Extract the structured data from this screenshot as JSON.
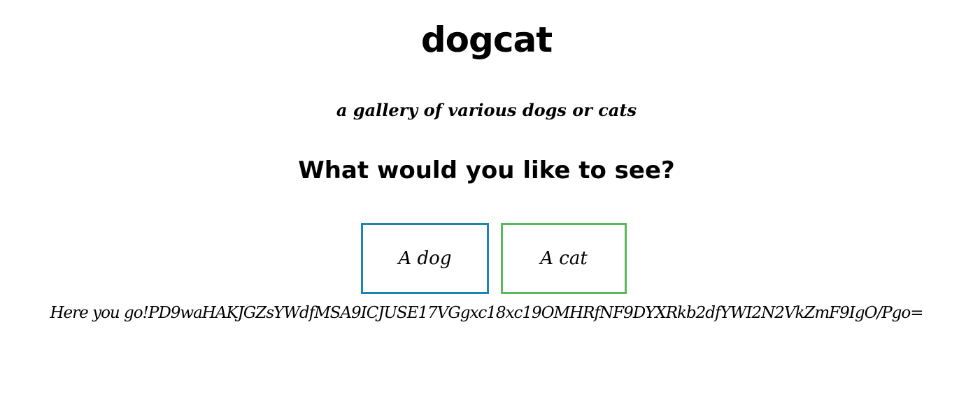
{
  "header": {
    "title": "dogcat",
    "subtitle": "a gallery of various dogs or cats"
  },
  "main": {
    "question": "What would you like to see?",
    "buttons": {
      "dog_label": "A dog",
      "cat_label": "A cat"
    },
    "result": {
      "prefix": "Here you go!",
      "payload": "PD9waHAKJGZsYWdfMSA9ICJUSE17VGgxc18xc19OMHRfNF9DYXRkb2dfYWI2N2VkZmF9IgO/Pgo="
    }
  },
  "colors": {
    "dog_button_border": "#1a86b8",
    "cat_button_border": "#5cb85c",
    "text": "#000000",
    "background": "#ffffff"
  }
}
